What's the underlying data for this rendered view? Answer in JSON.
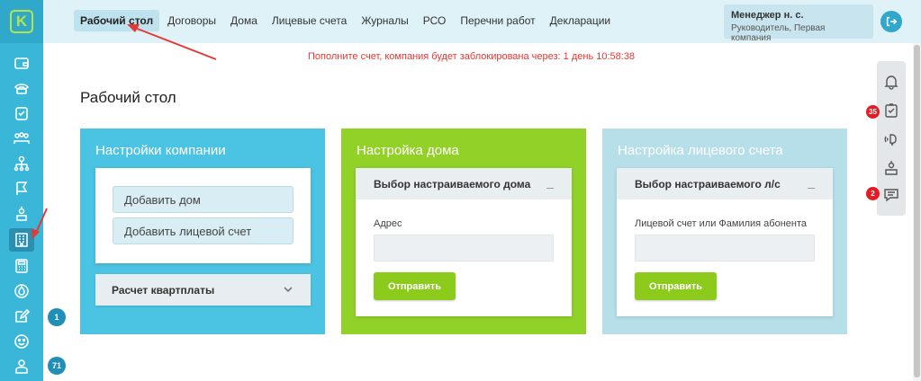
{
  "colors": {
    "sidebar": "#3ab7d8",
    "topbar": "#dff2f8",
    "accent_green": "#92d128",
    "warning": "#e53935",
    "badge_red": "#e51b23",
    "annotation_arrow": "#e53935"
  },
  "logo": {
    "letter": "K"
  },
  "nav": {
    "items": [
      {
        "label": "Рабочий стол",
        "active": true
      },
      {
        "label": "Договоры"
      },
      {
        "label": "Дома"
      },
      {
        "label": "Лицевые счета"
      },
      {
        "label": "Журналы"
      },
      {
        "label": "РСО"
      },
      {
        "label": "Перечни работ"
      },
      {
        "label": "Декларации"
      }
    ]
  },
  "user": {
    "name": "Менеджер н. с.",
    "role": "Руководитель, Первая компания"
  },
  "warning": "Пополните счет, компания будет заблокирована через: 1 день 10:58:38",
  "sidebar": {
    "icons": [
      "wallet-icon",
      "phone-icon",
      "clipboard-icon",
      "team-icon",
      "org-chart-icon",
      "flag-icon",
      "inspector-icon",
      "building-icon",
      "calculator-icon",
      "water-drop-icon",
      "edit-icon",
      "smiley-icon",
      "group-icon"
    ],
    "badges": {
      "edit": "1",
      "group": "71"
    }
  },
  "right_panel": {
    "icons": [
      "bell-icon",
      "task-icon",
      "broadcast-icon",
      "inspector-icon",
      "chat-icon"
    ],
    "badges": {
      "task": "35",
      "chat": "2"
    }
  },
  "page_title": "Рабочий стол",
  "cards": {
    "company": {
      "title": "Настройки компании",
      "add_house": "Добавить дом",
      "add_account": "Добавить лицевой счет",
      "accordion": "Расчет квартплаты"
    },
    "house": {
      "title": "Настройка дома",
      "panel_title": "Выбор настраиваемого дома",
      "minimize": "_",
      "field_label": "Адрес",
      "submit": "Отправить"
    },
    "account": {
      "title": "Настройка лицевого счета",
      "panel_title": "Выбор настраиваемого л/с",
      "minimize": "_",
      "field_label": "Лицевой счет или Фамилия абонента",
      "submit": "Отправить"
    }
  }
}
